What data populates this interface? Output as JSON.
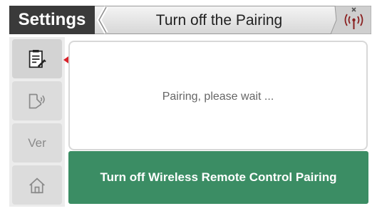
{
  "header": {
    "settings_label": "Settings",
    "title": "Turn off the Pairing",
    "status_icon": "wireless-disconnected-icon"
  },
  "sidebar": {
    "items": [
      {
        "icon": "clipboard-icon",
        "active": true
      },
      {
        "icon": "remote-signal-icon",
        "active": false
      },
      {
        "label": "Ver",
        "active": false
      },
      {
        "icon": "home-icon",
        "active": false
      }
    ]
  },
  "main": {
    "status_text": "Pairing, please wait ...",
    "action_label": "Turn off Wireless Remote Control Pairing"
  },
  "colors": {
    "header_dark": "#3a3a3a",
    "action_green": "#3b8d64",
    "active_marker": "#d9222a"
  }
}
